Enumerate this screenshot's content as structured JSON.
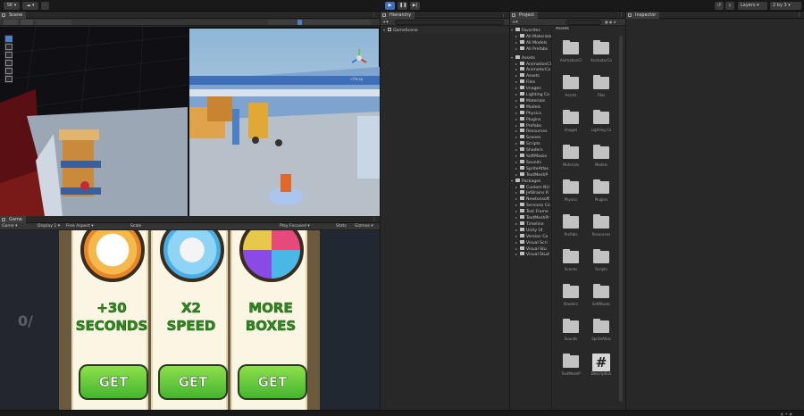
{
  "toolbar": {
    "account": "SK",
    "layers": "Layers",
    "layout": "2 by 3"
  },
  "scene": {
    "tab": "Scene",
    "persp": "<Persp"
  },
  "game": {
    "tab": "Game",
    "display_select": "Game",
    "display": "Display 1",
    "aspect": "Free Aspect",
    "scale": "Scale",
    "play_focused": "Play Focused",
    "stats": "Stats",
    "gizmos": "Gizmos",
    "cards": [
      {
        "line1": "+30",
        "line2": "SECONDS",
        "button": "GET"
      },
      {
        "line1": "X2",
        "line2": "SPEED",
        "button": "GET"
      },
      {
        "line1": "MORE",
        "line2": "BOXES",
        "button": "GET"
      }
    ],
    "side_text": "0/"
  },
  "hierarchy": {
    "tab": "Hierarchy",
    "root": "GameScene"
  },
  "project": {
    "tab": "Project",
    "favorites": {
      "label": "Favorites",
      "items": [
        "All Materials",
        "All Models",
        "All Prefabs"
      ]
    },
    "assets": {
      "label": "Assets",
      "items": [
        "AnimationCl",
        "AnimatorCo",
        "Assets",
        "Files",
        "Images",
        "Lighting Co",
        "Materials",
        "Models",
        "Physics",
        "Plugins",
        "Prefabs",
        "Resources",
        "Scenes",
        "Scripts",
        "Shaders",
        "SoftMasks",
        "Sounds",
        "SpriteAtlas",
        "TextMeshP"
      ]
    },
    "packages": {
      "label": "Packages",
      "items": [
        "Custom NU",
        "JetBrains R",
        "Newtonsoft",
        "Services Co",
        "Test Frame",
        "TextMeshPr",
        "Timeline",
        "Unity UI",
        "Version Co",
        "Visual Scri",
        "Visual Stu",
        "Visual Stud"
      ]
    },
    "grid_title": "Assets",
    "grid": [
      "AnimationCl",
      "AnimatorCo",
      "Assets",
      "Files",
      "Images",
      "Lighting Co",
      "Materials",
      "Models",
      "Physics",
      "Plugins",
      "Prefabs",
      "Resources",
      "Scenes",
      "Scripts",
      "Shaders",
      "SoftMasks",
      "Sounds",
      "SpriteAtlas",
      "TextMeshP",
      "Description"
    ]
  },
  "inspector": {
    "tab": "Inspector"
  },
  "colors": {
    "accent": "#4d7fc7",
    "green": "#44b530",
    "panel": "#282828"
  }
}
